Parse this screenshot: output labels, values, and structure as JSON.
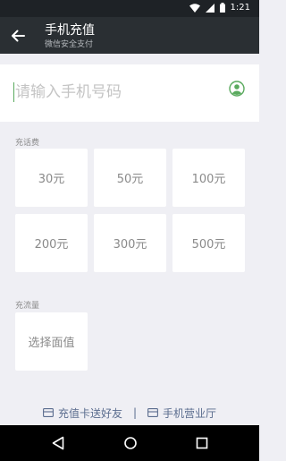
{
  "status_bar": {
    "time": "1:21",
    "icons": [
      "wifi-icon",
      "signal-icon",
      "battery-icon"
    ]
  },
  "header": {
    "title": "手机充值",
    "subtitle": "微信安全支付",
    "back_icon": "arrow-left-icon"
  },
  "phone_input": {
    "placeholder": "请输入手机号码",
    "value": "",
    "contact_icon": "contact-person-icon"
  },
  "topup": {
    "label": "充话费",
    "options": [
      "30元",
      "50元",
      "100元",
      "200元",
      "300元",
      "500元"
    ]
  },
  "data_plan": {
    "label": "充流量",
    "option": "选择面值"
  },
  "footer": {
    "links": [
      {
        "label": "充值卡送好友",
        "icon": "card-icon"
      },
      {
        "label": "手机营业厅",
        "icon": "store-card-icon"
      }
    ],
    "separator": "|"
  },
  "nav": {
    "icons": [
      "back-triangle-icon",
      "home-circle-icon",
      "recents-square-icon"
    ]
  },
  "colors": {
    "status_bar": "#1e2226",
    "title_bar": "#2a2f33",
    "background": "#efeff4",
    "accent_green": "#5aaa5e",
    "link_blue": "#5a6c8e"
  }
}
